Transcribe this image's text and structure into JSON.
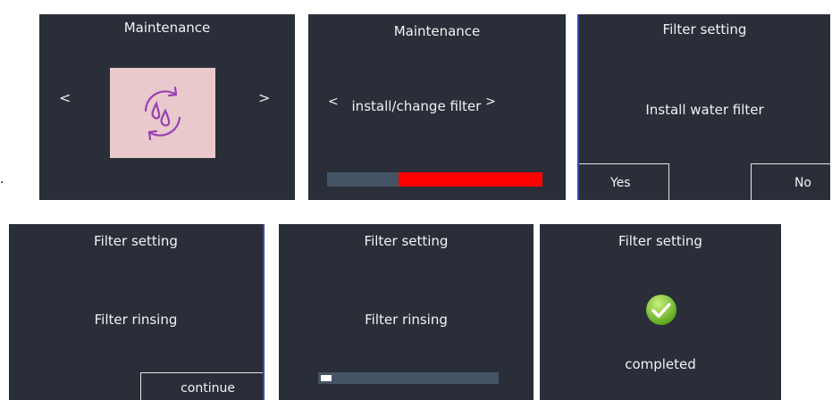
{
  "stray_dot": ".",
  "screens": [
    {
      "title": "Maintenance",
      "prev": "<",
      "next": ">",
      "icon": "water-filter-cycle-icon",
      "icon_bg": "#e9c9cc",
      "icon_color": "#9a3fb5"
    },
    {
      "title": "Maintenance",
      "prev": "<",
      "label": "install/change filter",
      "next": ">",
      "progress_fraction": 0.67,
      "progress_color": "#ff0000",
      "track_color": "#455465"
    },
    {
      "title": "Filter setting",
      "message": "Install water filter",
      "yes_label": "Yes",
      "no_label": "No"
    },
    {
      "title": "Filter setting",
      "message": "Filter rinsing",
      "continue_label": "continue"
    },
    {
      "title": "Filter setting",
      "message": "Filter rinsing",
      "progress_fraction": 0.06,
      "progress_color": "#ffffff"
    },
    {
      "title": "Filter setting",
      "status_icon": "check-circle-icon",
      "status_color": "#7cc63a",
      "message": "completed"
    }
  ]
}
